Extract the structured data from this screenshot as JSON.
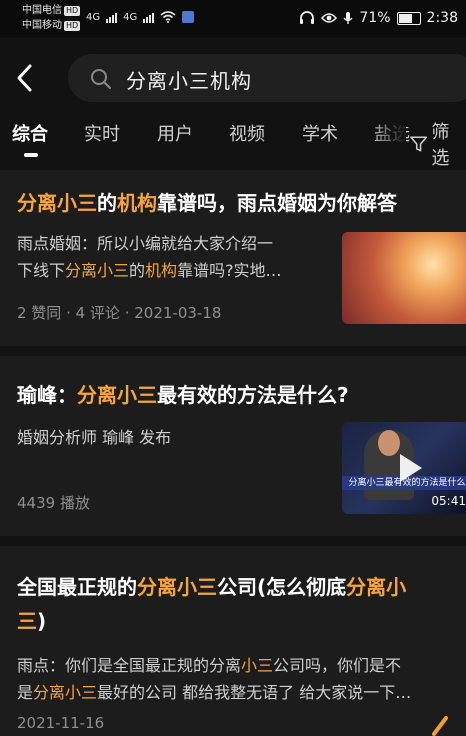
{
  "status": {
    "carrier1": "中国电信",
    "carrier2": "中国移动",
    "hd": "HD",
    "net1": "4G",
    "net2": "4G",
    "battery_text": "71%",
    "battery_level": 0.71,
    "time": "2:38"
  },
  "search": {
    "query": "分离小三机构"
  },
  "tabs": [
    "综合",
    "实时",
    "用户",
    "视频",
    "学术",
    "盐选"
  ],
  "filter_label": "筛选",
  "results": [
    {
      "title": [
        "分离小三",
        "的",
        "机构",
        "靠谱吗，雨点婚姻为你解答"
      ],
      "snippet_l1": "雨点婚姻：所以小编就给大家介绍一",
      "snippet_l2": [
        "下线下",
        "分离小三",
        "的",
        "机构",
        "靠谱吗?实地…"
      ],
      "meta": "2 赞同 · 4 评论 · 2021-03-18"
    },
    {
      "title": [
        "瑜峰：",
        "分离小三",
        "最有效的方法是什么?"
      ],
      "author": "婚姻分析师 瑜峰 发布",
      "plays": "4439 播放",
      "video_caption": "分离小三最有效的方法是什么",
      "duration": "05:41"
    },
    {
      "title_l1": [
        "全国最正规的",
        "分离小三",
        "公司(怎么彻底",
        "分离小"
      ],
      "title_l2": [
        "三",
        ")"
      ],
      "snippet_l1": [
        "雨点：你们是全国最正规的分离",
        "小三",
        "公司吗，你们是不"
      ],
      "snippet_l2": [
        "是",
        "分离小三",
        "最好的公司 都给我整无语了 给大家说一下…"
      ],
      "date": "2021-11-16"
    }
  ],
  "colors": {
    "highlight": "#f7a43b",
    "background": "#121212",
    "card": "#1c1c1c"
  }
}
